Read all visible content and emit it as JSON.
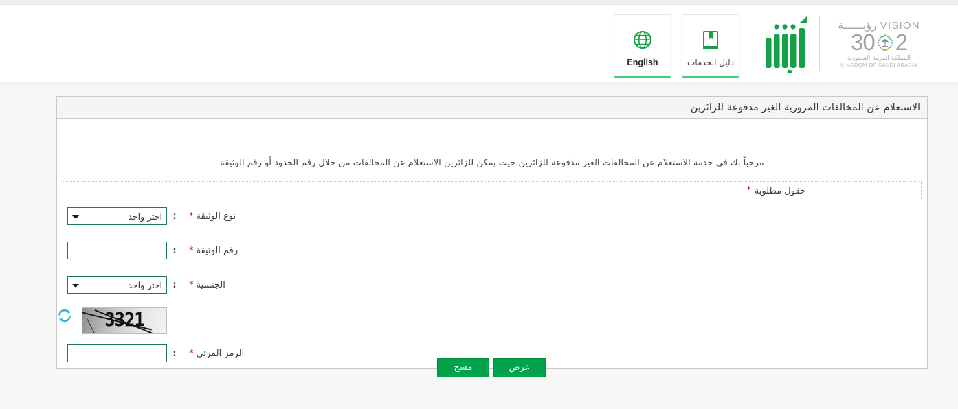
{
  "header": {
    "actions": [
      {
        "label": "English",
        "icon": "globe-icon",
        "name": "english-language-button"
      },
      {
        "label": "دليل الخدمات",
        "icon": "book-bookmark-icon",
        "name": "services-guide-button"
      }
    ],
    "vision_logo": {
      "word_ar": "رؤيــــــة",
      "word_en": "VISION",
      "num_left": "2",
      "num_right": "30",
      "sub_ar": "المملكة العربية السعودية",
      "sub_en": "KINGDOM OF SAUDI ARABIA"
    },
    "absher_logo_alt": "أبشر"
  },
  "panel": {
    "title": "الاستعلام عن المخالفات المرورية الغير مدفوعة للزائرين",
    "intro": "مرحباً بك في خدمة الاستعلام عن المخالفات الغير مدفوعة للزائرين حيث يمكن للزائرين الاستعلام عن المخالفات من خلال رقم الحدود أو رقم الوثيقة",
    "required_note": "حقول مطلوبة",
    "required_marker": "*",
    "colon": ":"
  },
  "form": {
    "fields": [
      {
        "label": "نوع الوثيقة",
        "required": true,
        "type": "select",
        "value": "اختر واحد",
        "options": [
          "اختر واحد"
        ],
        "name": "document-type-select"
      },
      {
        "label": "رقم الوثيقة",
        "required": true,
        "type": "text",
        "value": "",
        "placeholder": "",
        "name": "document-number-input"
      },
      {
        "label": "الجنسية",
        "required": true,
        "type": "select",
        "value": "اختر واحد",
        "options": [
          "اختر واحد"
        ],
        "name": "nationality-select"
      }
    ],
    "captcha": {
      "code": "3321",
      "refresh_icon": "refresh-icon",
      "label": "الرمز المرئي",
      "required": true,
      "value": "",
      "placeholder": ""
    }
  },
  "buttons": {
    "submit_label": "عرض",
    "clear_label": "مسح"
  },
  "colors": {
    "brand_green": "#00a24b",
    "field_border_green": "#1e7a4d",
    "required_red": "#e01b1b",
    "card_accent": "#3ad07f",
    "refresh_cyan": "#2bb7d6"
  }
}
